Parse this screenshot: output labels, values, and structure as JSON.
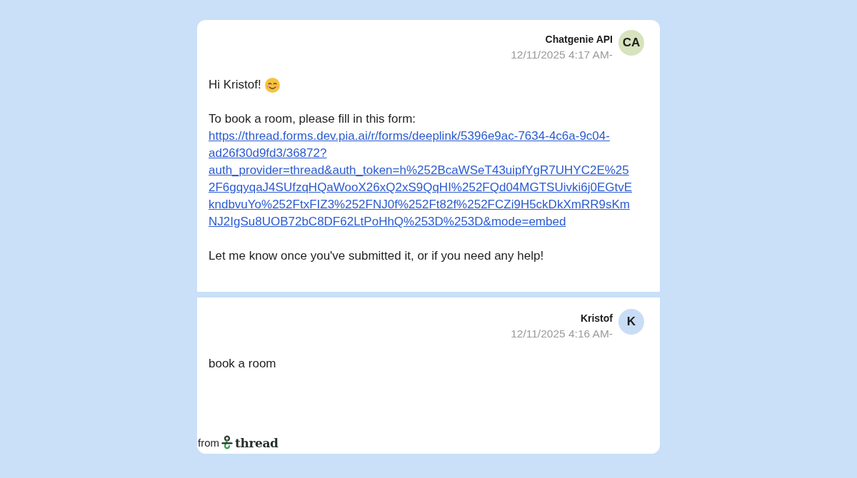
{
  "messages": [
    {
      "sender": "Chatgenie API",
      "timestamp": "12/11/2025 4:17 AM-",
      "avatar": {
        "initials": "CA",
        "color": "#d6e3bd"
      },
      "paragraphs": [
        {
          "lines": [
            {
              "kind": "text",
              "text": "Hi Kristof!",
              "emoji": true
            }
          ]
        },
        {
          "lines": [
            {
              "kind": "text",
              "text": "To book a room, please fill in this form:"
            },
            {
              "kind": "link",
              "text": "https://thread.forms.dev.pia.ai/r/forms/deeplink/5396e9ac-7634-4c6a-9c04-ad26f30d9fd3/36872?auth_provider=thread&auth_token=h%252BcaWSeT43uipfYgR7UHYC2E%252F6gqyqaJ4SUfzqHQaWooX26xQ2xS9QqHI%252FQd04MGTSUivki6j0EGtvEkndbvuYo%252FtxFIZ3%252FNJ0f%252Ft82f%252FCZi9H5ckDkXmRR9sKmNJ2IgSu8UOB72bC8DF62LtPoHhQ%253D%253D&mode=embed"
            }
          ]
        },
        {
          "lines": [
            {
              "kind": "text",
              "text": "Let me know once you've submitted it, or if you need any help!"
            }
          ]
        }
      ]
    },
    {
      "sender": "Kristof",
      "timestamp": "12/11/2025 4:16 AM-",
      "avatar": {
        "initials": "K",
        "color": "#c9dcf6"
      },
      "paragraphs": [
        {
          "lines": [
            {
              "kind": "text",
              "text": "book a room"
            }
          ]
        }
      ]
    }
  ],
  "footer": {
    "prefix": "from",
    "brand": "thread"
  }
}
